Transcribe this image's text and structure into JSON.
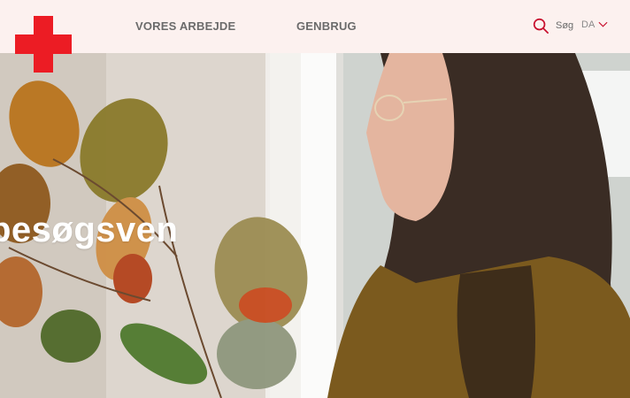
{
  "header": {
    "logo_name": "red-cross-logo",
    "nav": [
      {
        "label": "VORES ARBEJDE"
      },
      {
        "label": "GENBRUG"
      }
    ],
    "search_label": "Søg",
    "language": "DA"
  },
  "hero": {
    "title": "besøgsven"
  },
  "colors": {
    "brand_red": "#ec1c24",
    "header_bg": "#fcf1ef",
    "nav_text": "#6b6b6b"
  }
}
